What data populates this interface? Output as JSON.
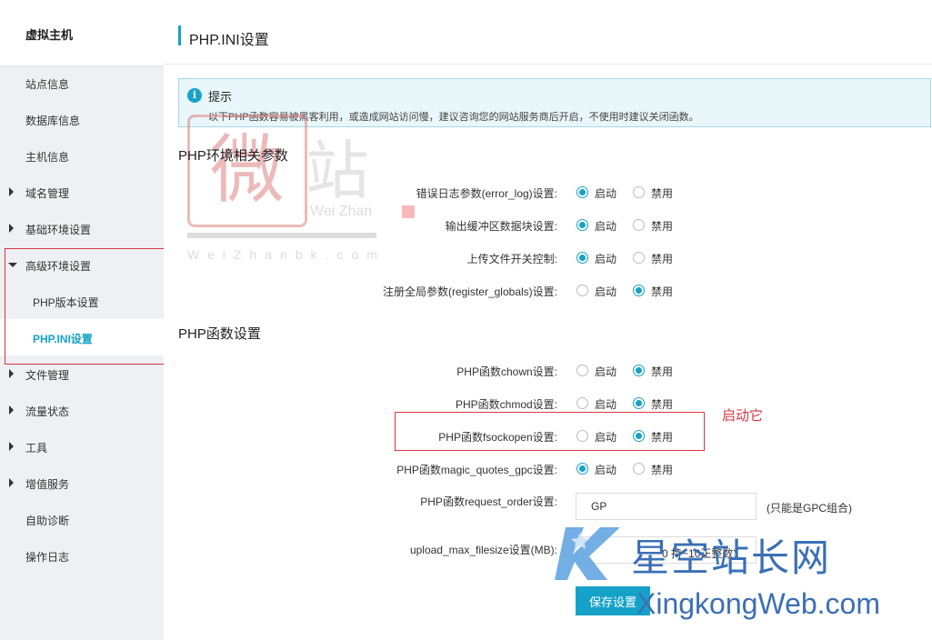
{
  "sidebar": {
    "title": "虚拟主机",
    "items": [
      {
        "label": "站点信息",
        "arrow": "none"
      },
      {
        "label": "数据库信息",
        "arrow": "none"
      },
      {
        "label": "主机信息",
        "arrow": "none"
      },
      {
        "label": "域名管理",
        "arrow": "right"
      },
      {
        "label": "基础环境设置",
        "arrow": "right"
      },
      {
        "label": "高级环境设置",
        "arrow": "down"
      },
      {
        "label": "PHP版本设置",
        "arrow": "none"
      },
      {
        "label": "PHP.INI设置",
        "arrow": "none",
        "active": true
      },
      {
        "label": "文件管理",
        "arrow": "right"
      },
      {
        "label": "流量状态",
        "arrow": "right"
      },
      {
        "label": "工具",
        "arrow": "right"
      },
      {
        "label": "增值服务",
        "arrow": "right"
      },
      {
        "label": "自助诊断",
        "arrow": "none"
      },
      {
        "label": "操作日志",
        "arrow": "none"
      }
    ]
  },
  "page": {
    "title": "PHP.INI设置"
  },
  "tip": {
    "icon": "info-icon",
    "title": "提示",
    "text": "以下PHP函数容易被黑客利用，或造成网站访问慢，建议咨询您的网站服务商后开启，不使用时建议关闭函数。"
  },
  "env_section": {
    "title": "PHP环境相关参数",
    "rows": [
      {
        "label": "错误日志参数(error_log)设置:",
        "on_label": "启动",
        "off_label": "禁用",
        "value": "on"
      },
      {
        "label": "输出缓冲区数据块设置:",
        "on_label": "启动",
        "off_label": "禁用",
        "value": "on"
      },
      {
        "label": "上传文件开关控制:",
        "on_label": "启动",
        "off_label": "禁用",
        "value": "on"
      },
      {
        "label": "注册全局参数(register_globals)设置:",
        "on_label": "启动",
        "off_label": "禁用",
        "value": "off"
      }
    ]
  },
  "func_section": {
    "title": "PHP函数设置",
    "rows": [
      {
        "label": "PHP函数chown设置:",
        "on_label": "启动",
        "off_label": "禁用",
        "value": "off"
      },
      {
        "label": "PHP函数chmod设置:",
        "on_label": "启动",
        "off_label": "禁用",
        "value": "off"
      },
      {
        "label": "PHP函数fsockopen设置:",
        "on_label": "启动",
        "off_label": "禁用",
        "value": "off"
      },
      {
        "label": "PHP函数magic_quotes_gpc设置:",
        "on_label": "启动",
        "off_label": "禁用",
        "value": "on"
      }
    ],
    "request_order": {
      "label": "PHP函数request_order设置:",
      "value": "GP",
      "hint": "(只能是GPC组合)"
    },
    "upload_max": {
      "label": "upload_max_filesize设置(MB):",
      "value": "",
      "hint": "0 持~10正整数)"
    }
  },
  "annotation": "启动它",
  "save_label": "保存设置",
  "watermarks": {
    "top_seal_char": "微",
    "top_char": "站",
    "top_latin": "Wei Zhan",
    "top_url": "WeiZhanbk.com",
    "bottom_cn": "星空站长网",
    "bottom_en": "XingkongWeb.com"
  },
  "colors": {
    "accent": "#16a2c8",
    "annotation": "#d9363e",
    "sidebar_bg": "#eef0f3",
    "tip_bg": "#e9f6fa"
  }
}
